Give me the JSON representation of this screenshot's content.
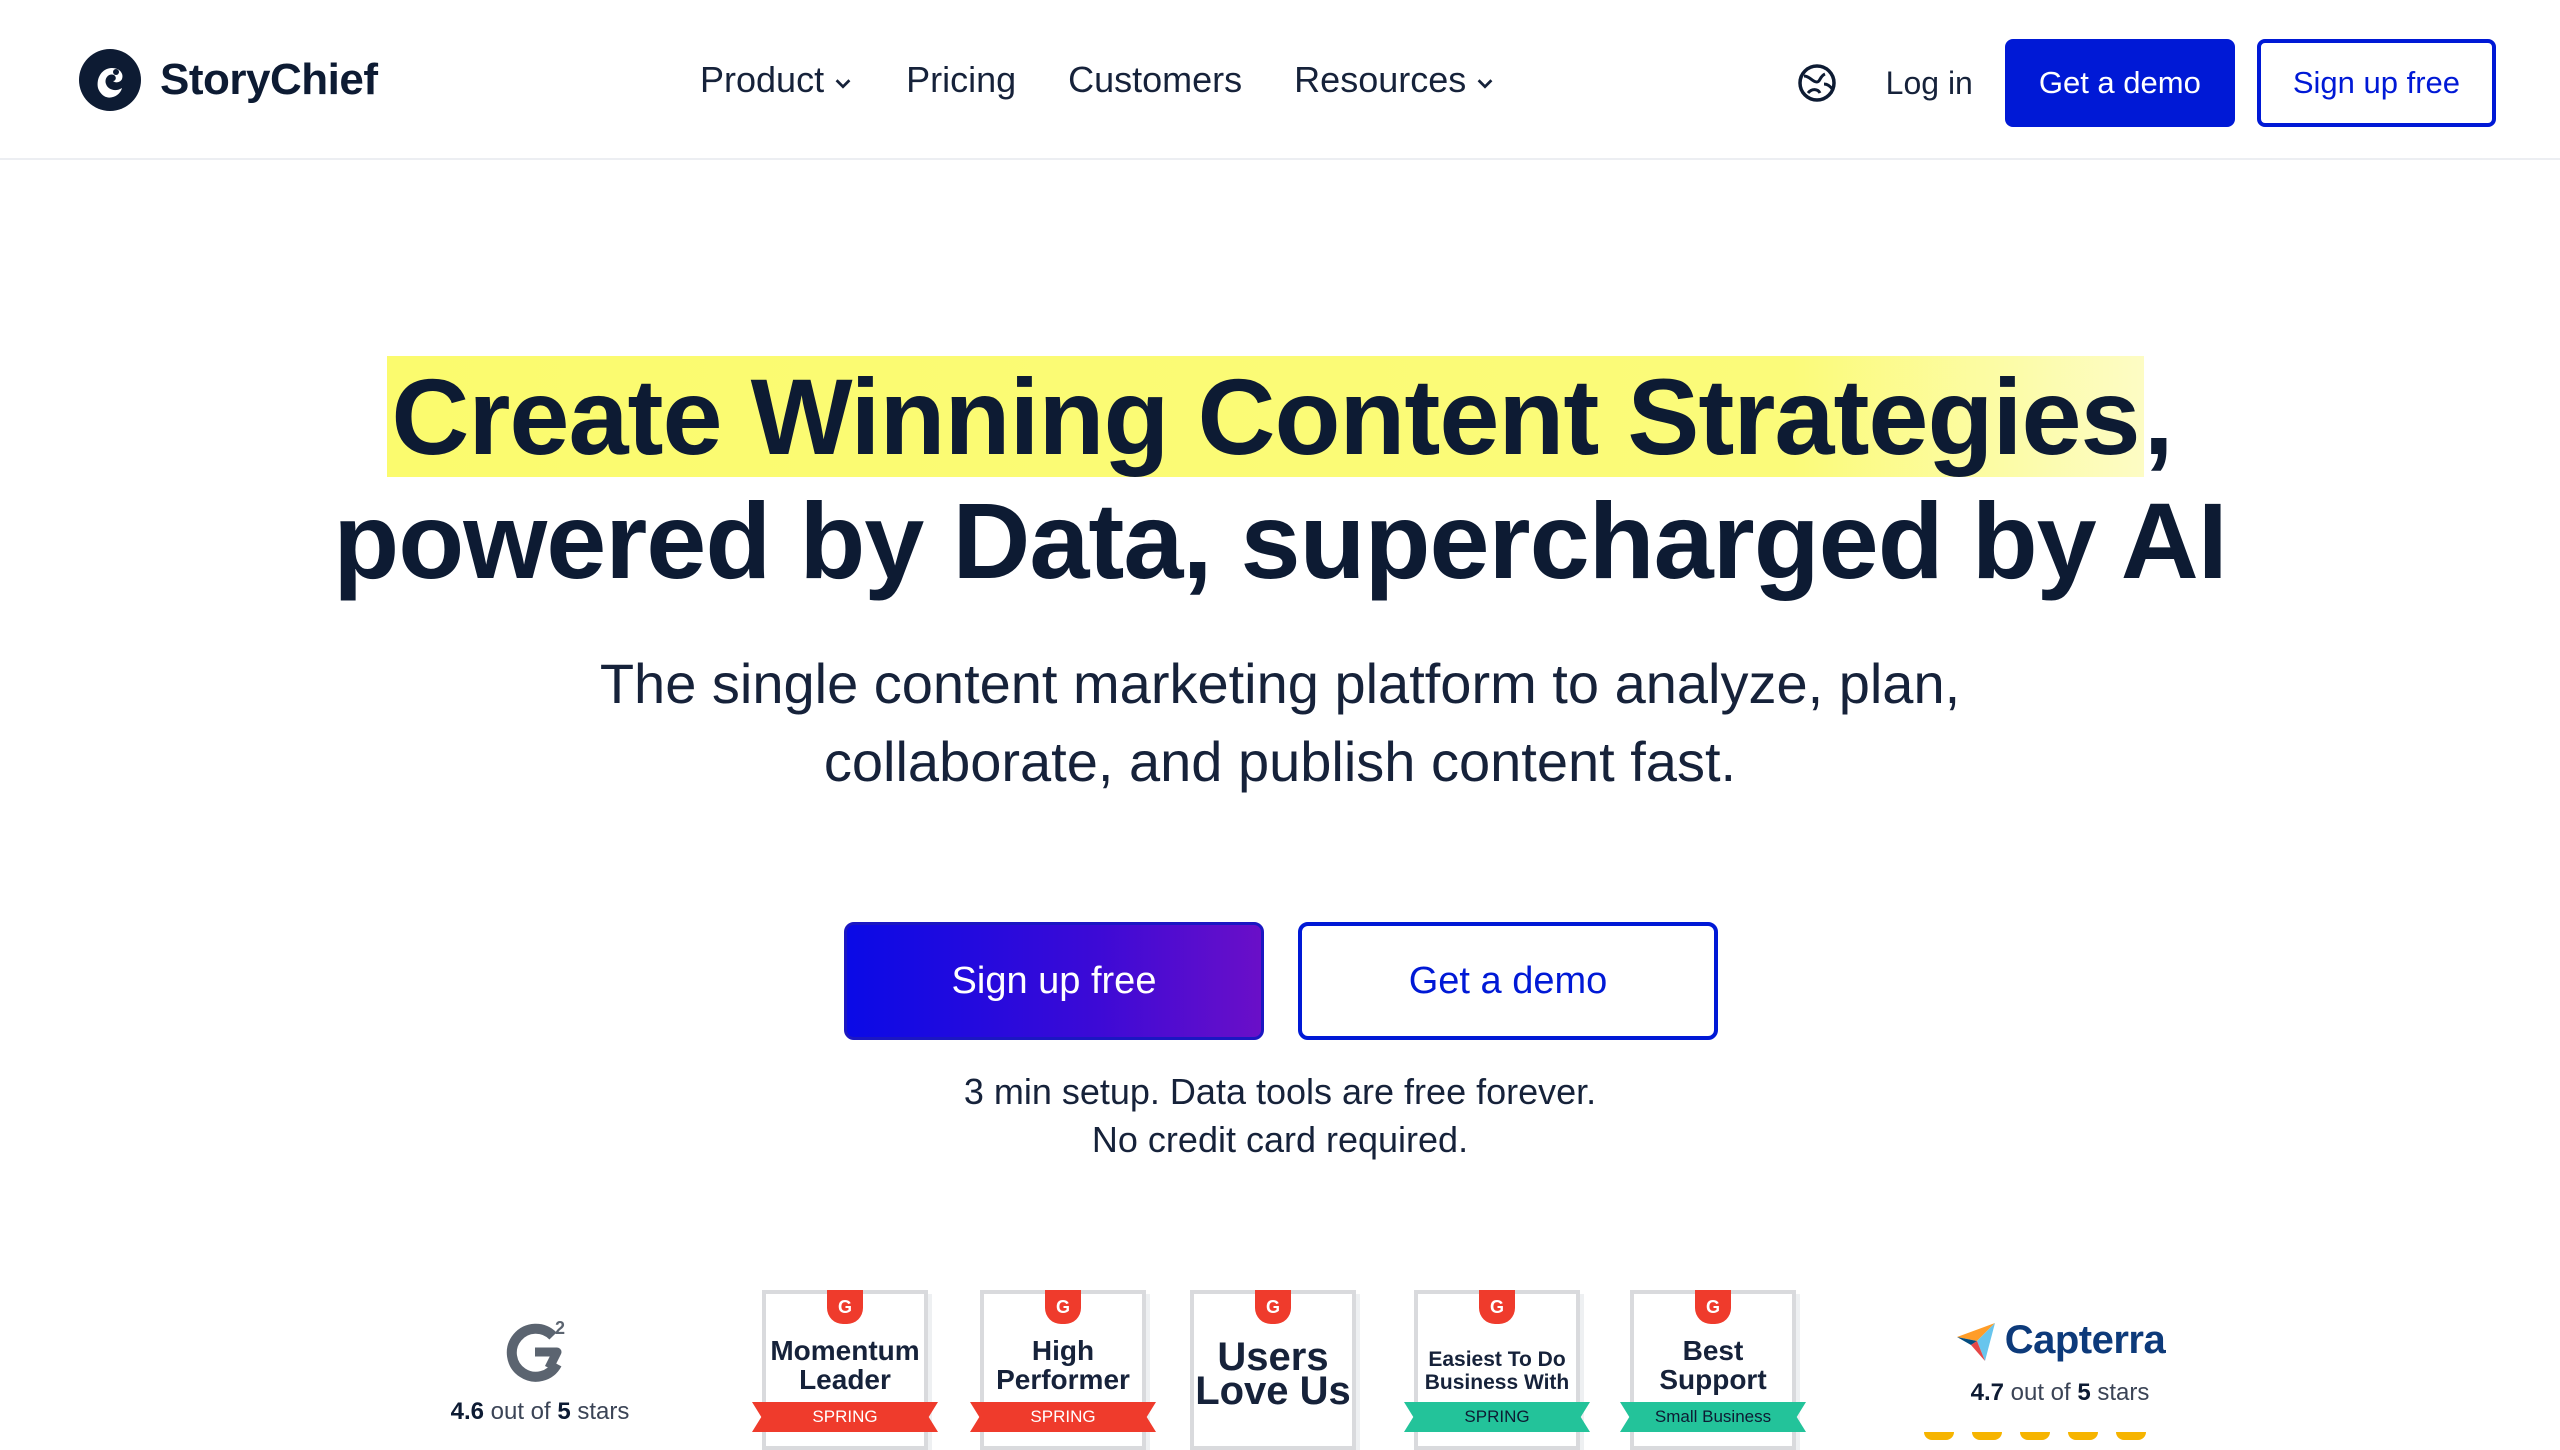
{
  "brand": {
    "name": "StoryChief"
  },
  "nav": {
    "items": [
      {
        "label": "Product",
        "has_dropdown": true
      },
      {
        "label": "Pricing",
        "has_dropdown": false
      },
      {
        "label": "Customers",
        "has_dropdown": false
      },
      {
        "label": "Resources",
        "has_dropdown": true
      }
    ],
    "language_icon": "globe-icon",
    "login_label": "Log in",
    "demo_label": "Get a demo",
    "signup_label": "Sign up free"
  },
  "hero": {
    "headline_highlight": "Create Winning Content Strategies",
    "headline_highlight_tail": ",",
    "headline_line2": "powered by Data, supercharged by AI",
    "subtitle_line1": "The single content marketing platform to analyze, plan,",
    "subtitle_line2": "collaborate, and publish content fast.",
    "cta_primary": "Sign up free",
    "cta_secondary": "Get a demo",
    "note_line1": "3 min setup. Data tools are free forever.",
    "note_line2": "No credit card required."
  },
  "ratings": {
    "g2": {
      "score": "4.6",
      "pre": "out of",
      "max": "5",
      "post": "stars"
    },
    "capterra": {
      "name": "Capterra",
      "score": "4.7",
      "pre": "out of",
      "max": "5",
      "post": "stars"
    }
  },
  "badges": [
    {
      "line1": "Momentum",
      "line2": "Leader",
      "ribbon": "SPRING",
      "ribbon_color": "#ef3b2c"
    },
    {
      "line1": "High",
      "line2": "Performer",
      "ribbon": "SPRING",
      "ribbon_color": "#ef3b2c"
    },
    {
      "line1": "Users",
      "line2": "Love Us",
      "ribbon": "",
      "ribbon_color": ""
    },
    {
      "line1": "Easiest To Do",
      "line2": "Business With",
      "ribbon": "SPRING",
      "ribbon_color": "#23c39a"
    },
    {
      "line1": "Best",
      "line2": "Support",
      "ribbon": "Small Business",
      "ribbon_color": "#23c39a"
    }
  ],
  "colors": {
    "brand_blue": "#0019d6",
    "text_dark": "#0d1b33",
    "highlight_yellow": "#fbfb6e",
    "g2_red": "#ef3b2c"
  }
}
